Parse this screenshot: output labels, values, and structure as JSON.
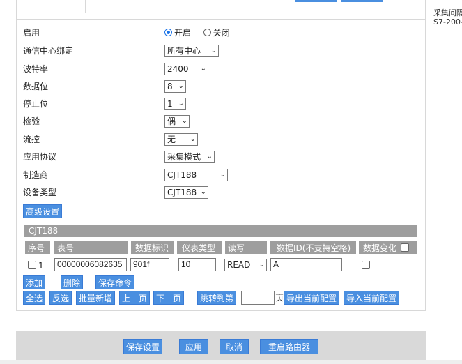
{
  "form": {
    "enable": {
      "label": "启用",
      "on": "开启",
      "off": "关闭"
    },
    "center_binding": {
      "label": "通信中心绑定",
      "value": "所有中心"
    },
    "baud_rate": {
      "label": "波特率",
      "value": "2400"
    },
    "data_bits": {
      "label": "数据位",
      "value": "8"
    },
    "stop_bits": {
      "label": "停止位",
      "value": "1"
    },
    "parity": {
      "label": "检验",
      "value": "偶"
    },
    "flow_control": {
      "label": "流控",
      "value": "无"
    },
    "app_protocol": {
      "label": "应用协议",
      "value": "采集模式"
    },
    "manufacturer": {
      "label": "制造商",
      "value": "CJT188"
    },
    "device_type": {
      "label": "设备类型",
      "value": "CJT188"
    },
    "advanced_button": "高级设置"
  },
  "table": {
    "title": "CJT188",
    "headers": [
      "序号",
      "表号",
      "数据标识",
      "仪表类型",
      "读写",
      "数据ID(不支持空格)",
      "数据变化"
    ],
    "rows": [
      {
        "index": "1",
        "meter_no": "00000006082635",
        "data_flag": "901f",
        "meter_type": "10",
        "rw": "READ",
        "data_id": "A"
      }
    ]
  },
  "actions": {
    "add": "添加",
    "delete": "删除",
    "save_cmd": "保存命令",
    "select_all": "全选",
    "invert": "反选",
    "batch_add": "批量新增",
    "prev_page": "上一页",
    "next_page": "下一页",
    "jump_to": "跳转到第",
    "page_suffix": "页",
    "export": "导出当前配置",
    "import": "导入当前配置"
  },
  "footer": {
    "save": "保存设置",
    "apply": "应用",
    "cancel": "取消",
    "reboot": "重启路由器"
  },
  "sidebar": {
    "line1": "采集间隔",
    "line2": "S7-200-"
  },
  "colors": {
    "accent": "#4a8fe0",
    "header_gray": "#9e9e9e",
    "footer_gray": "#d9d9d9"
  }
}
